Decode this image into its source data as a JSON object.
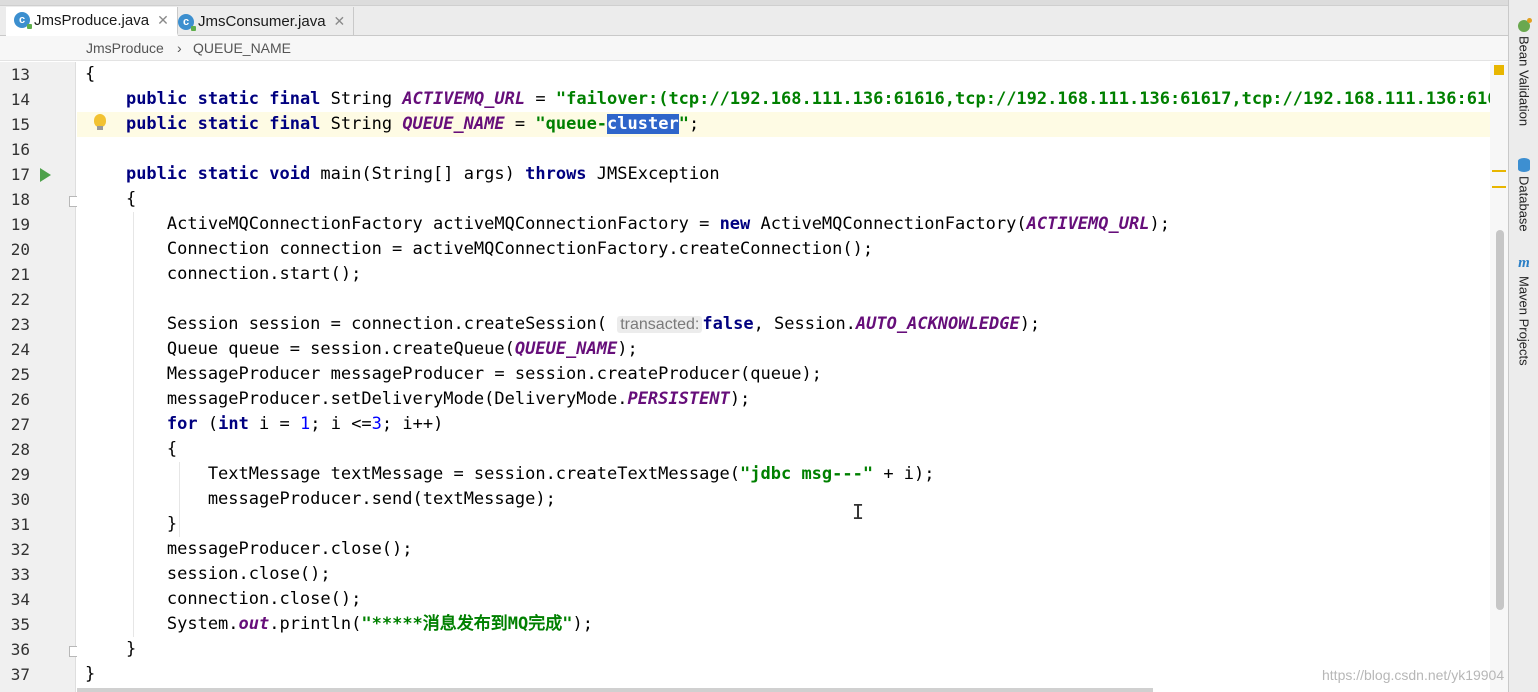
{
  "tabs": [
    {
      "label": "JmsProduce.java",
      "active": true,
      "icon": "java-class-icon"
    },
    {
      "label": "JmsConsumer.java",
      "active": false,
      "icon": "java-class-icon"
    }
  ],
  "breadcrumb": {
    "class": "JmsProduce",
    "separator": "›",
    "field": "QUEUE_NAME"
  },
  "editor": {
    "line_numbers": [
      "13",
      "14",
      "15",
      "16",
      "17",
      "18",
      "19",
      "20",
      "21",
      "22",
      "23",
      "24",
      "25",
      "26",
      "27",
      "28",
      "29",
      "30",
      "31",
      "32",
      "33",
      "34",
      "35",
      "36",
      "37"
    ],
    "current_line": "15",
    "selected_text": "cluster",
    "hint_label": "transacted:"
  },
  "tool_windows": [
    {
      "label": "Bean Validation",
      "icon": "bean-icon"
    },
    {
      "label": "Database",
      "icon": "database-icon"
    },
    {
      "label": "Maven Projects",
      "icon": "maven-icon"
    }
  ],
  "watermark": "https://blog.csdn.net/yk19904",
  "colors": {
    "keyword": "#000080",
    "string": "#008000",
    "constant": "#660e7a",
    "number": "#0000ff",
    "selection": "#2f65ca",
    "current_line": "#fefbe4"
  }
}
